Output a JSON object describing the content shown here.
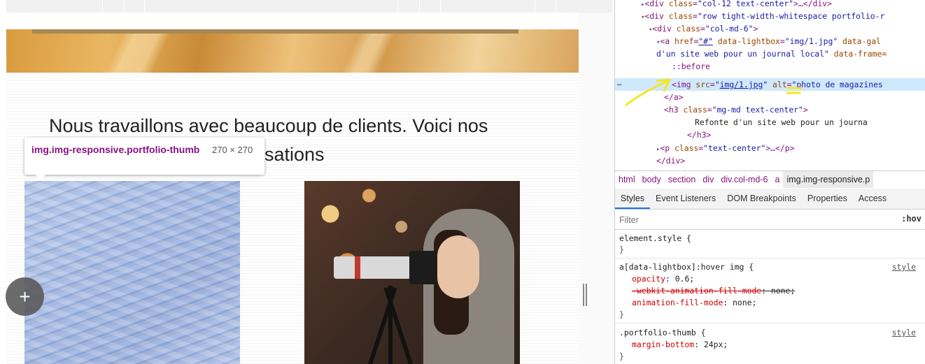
{
  "page": {
    "heading": "Nous travaillons avec beaucoup de clients. Voici nos",
    "tooltip": {
      "selector": "img.img-responsive.portfolio-thumb",
      "dimensions": "270 × 270"
    },
    "heading_visible_tail": "sations",
    "plus_label": "+"
  },
  "devtools": {
    "dom_lines": [
      {
        "indent": 3,
        "parts": [
          [
            "tri",
            "▸"
          ],
          [
            "tag",
            "<div "
          ],
          [
            "an",
            "class"
          ],
          [
            "tag",
            "="
          ],
          [
            "av",
            "\"col-12 text-center\""
          ],
          [
            "tag",
            ">…</div>"
          ]
        ]
      },
      {
        "indent": 3,
        "parts": [
          [
            "tri",
            "▾"
          ],
          [
            "tag",
            "<div "
          ],
          [
            "an",
            "class"
          ],
          [
            "tag",
            "="
          ],
          [
            "av",
            "\"row tight-width-whitespace portfolio-r"
          ]
        ]
      },
      {
        "indent": 4,
        "parts": [
          [
            "tri",
            "▾"
          ],
          [
            "tag",
            "<div "
          ],
          [
            "an",
            "class"
          ],
          [
            "tag",
            "="
          ],
          [
            "av",
            "\"col-md-6\""
          ],
          [
            "tag",
            ">"
          ]
        ]
      },
      {
        "indent": 5,
        "parts": [
          [
            "tri",
            "▾"
          ],
          [
            "tag",
            "<a "
          ],
          [
            "an",
            "href"
          ],
          [
            "tag",
            "="
          ],
          [
            "lnk",
            "\"#\""
          ],
          [
            "an",
            " data-lightbox"
          ],
          [
            "tag",
            "="
          ],
          [
            "av",
            "\"img/1.jpg\""
          ],
          [
            "an",
            " data-gal"
          ]
        ]
      },
      {
        "indent": 5,
        "parts": [
          [
            "av",
            "d'un site web pour un journal local\""
          ],
          [
            "an",
            " data-frame="
          ]
        ]
      },
      {
        "indent": 7,
        "parts": [
          [
            "pseudo",
            "::before"
          ]
        ]
      },
      {
        "indent": 7,
        "sel": true,
        "parts": [
          [
            "tag",
            "<img "
          ],
          [
            "an",
            "src"
          ],
          [
            "tag",
            "="
          ],
          [
            "av",
            "\""
          ],
          [
            "lnk",
            "img/1.jpg"
          ],
          [
            "av",
            "\""
          ],
          [
            "an",
            " alt"
          ],
          [
            "tag",
            "="
          ],
          [
            "av",
            "\"photo de magazines"
          ]
        ]
      },
      {
        "indent": 6,
        "parts": [
          [
            "tag",
            "</a>"
          ]
        ]
      },
      {
        "indent": 6,
        "parts": [
          [
            "tag",
            "<h3 "
          ],
          [
            "an",
            "class"
          ],
          [
            "tag",
            "="
          ],
          [
            "av",
            "\"mg-md text-center\""
          ],
          [
            "tag",
            ">"
          ]
        ]
      },
      {
        "indent": 10,
        "parts": [
          [
            "pv",
            "Refonte d'un site web pour un journa"
          ]
        ]
      },
      {
        "indent": 9,
        "parts": [
          [
            "tag",
            "</h3>"
          ]
        ]
      },
      {
        "indent": 5,
        "parts": [
          [
            "tri",
            "▸"
          ],
          [
            "tag",
            "<p "
          ],
          [
            "an",
            "class"
          ],
          [
            "tag",
            "="
          ],
          [
            "av",
            "\"text-center\""
          ],
          [
            "tag",
            ">…</p>"
          ]
        ]
      },
      {
        "indent": 5,
        "parts": [
          [
            "tag",
            "</div>"
          ]
        ]
      }
    ],
    "breadcrumbs": [
      "html",
      "body",
      "section",
      "div",
      "div.col-md-6",
      "a",
      "img.img-responsive.p"
    ],
    "tabs": [
      "Styles",
      "Event Listeners",
      "DOM Breakpoints",
      "Properties",
      "Access"
    ],
    "filter_placeholder": "Filter",
    "hov_label": ":hov",
    "rules": {
      "element_style": "element.style {",
      "close": "}",
      "hover_selector": "a[data-lightbox]:hover img {",
      "hover_source": "style",
      "hover_props": [
        {
          "name": "opacity",
          "value": "0.6;",
          "struck": false
        },
        {
          "name": "-webkit-animation-fill-mode",
          "value": "none;",
          "struck": true
        },
        {
          "name": "animation-fill-mode",
          "value": "none;",
          "struck": false
        }
      ],
      "thumb_selector": ".portfolio-thumb {",
      "thumb_source": "style",
      "thumb_props": [
        {
          "name": "margin-bottom",
          "value": "24px;",
          "struck": false
        }
      ]
    }
  },
  "colors": {
    "selected_row": "#cfe8fc",
    "tag": "#881280",
    "attr_name": "#994500",
    "attr_value": "#1a1aa6",
    "css_prop": "#c80000",
    "annotation": "#f5e625"
  }
}
